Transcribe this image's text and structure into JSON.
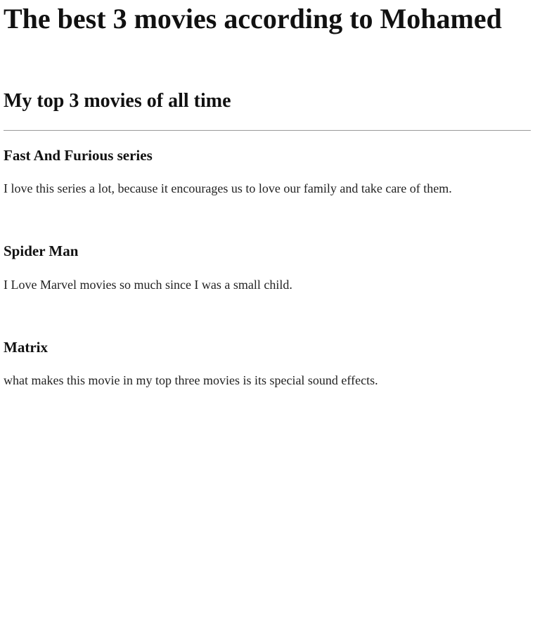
{
  "page": {
    "title": "The best 3 movies according to Mohamed",
    "section_title": "My top 3 movies of all time"
  },
  "movies": [
    {
      "title": "Fast And Furious series",
      "description": "I love this series a lot, because it encourages us to love our family and take care of them."
    },
    {
      "title": "Spider Man",
      "description": "I Love Marvel movies so much since I was a small child."
    },
    {
      "title": "Matrix",
      "description": "what makes this movie in my top three movies is its special sound effects."
    }
  ]
}
